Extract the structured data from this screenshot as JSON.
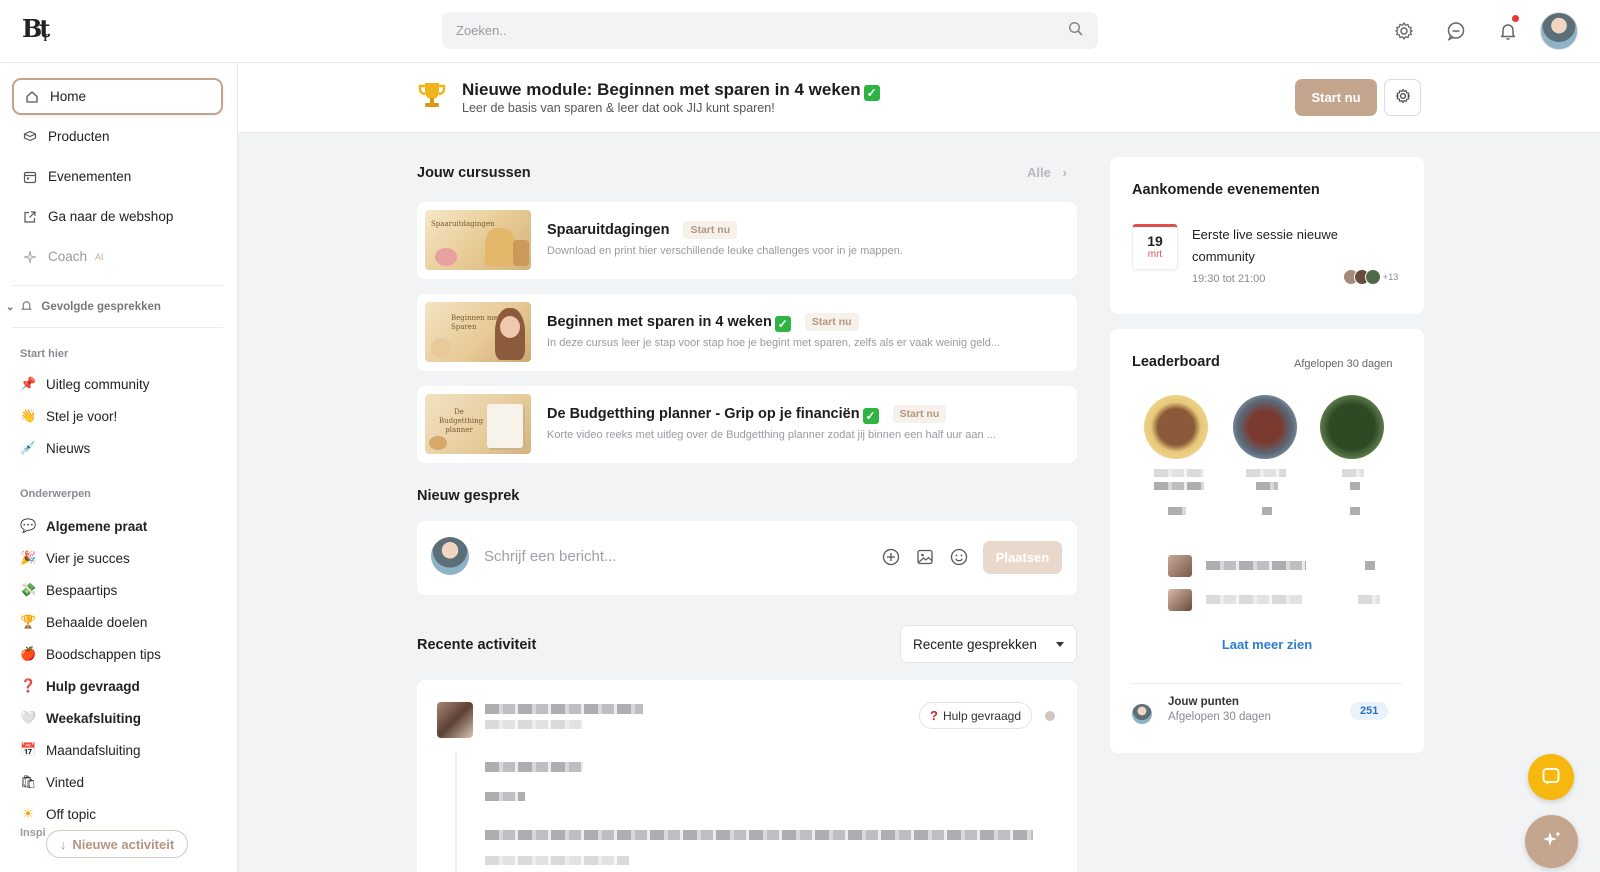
{
  "header": {
    "search_placeholder": "Zoeken..",
    "icons": [
      "settings-gear-icon",
      "chat-bubble-icon",
      "bell-icon"
    ]
  },
  "sidebar": {
    "items": [
      {
        "label": "Home",
        "icon": "home-icon",
        "active": true
      },
      {
        "label": "Producten",
        "icon": "box-icon"
      },
      {
        "label": "Evenementen",
        "icon": "calendar-icon"
      },
      {
        "label": "Ga naar de webshop",
        "icon": "external-link-icon"
      },
      {
        "label": "Coach",
        "icon": "sparkle-icon",
        "tag": "AI"
      }
    ],
    "followed": "Gevolgde gesprekken",
    "section_start": "Start hier",
    "start_channels": [
      {
        "label": "Uitleg community",
        "emoji": "📌"
      },
      {
        "label": "Stel je voor!",
        "emoji": "👋"
      },
      {
        "label": "Nieuws",
        "emoji": "💉"
      }
    ],
    "section_topics": "Onderwerpen",
    "topic_channels": [
      {
        "label": "Algemene praat",
        "emoji": "💬",
        "bold": true
      },
      {
        "label": "Vier je succes",
        "emoji": "🎉"
      },
      {
        "label": "Bespaartips",
        "emoji": "💸"
      },
      {
        "label": "Behaalde doelen",
        "emoji": "🏆"
      },
      {
        "label": "Boodschappen tips",
        "emoji": "🍎"
      },
      {
        "label": "Hulp gevraagd",
        "emoji": "❓",
        "bold": true
      },
      {
        "label": "Weekafsluiting",
        "emoji": "🤍",
        "bold": true
      },
      {
        "label": "Maandafsluiting",
        "emoji": "📅"
      },
      {
        "label": "Vinted",
        "emoji": "🛍"
      },
      {
        "label": "Off topic",
        "emoji": "☀"
      }
    ],
    "section_inspi": "Inspi",
    "new_activity": "Nieuwe activiteit"
  },
  "banner": {
    "title": "Nieuwe module: Beginnen met sparen in 4 weken",
    "subtitle": "Leer de basis van sparen & leer dat ook JIJ kunt sparen!",
    "start_label": "Start nu"
  },
  "courses": {
    "heading": "Jouw cursussen",
    "all_label": "Alle",
    "items": [
      {
        "title": "Spaaruitdagingen",
        "check": false,
        "badge": "Start nu",
        "desc": "Download en print hier verschillende leuke challenges voor in je mappen.",
        "thumb_text": "Spaaruitdagingen"
      },
      {
        "title": "Beginnen met sparen in 4 weken",
        "check": true,
        "badge": "Start nu",
        "desc": "In deze cursus leer je stap voor stap hoe je begint met sparen, zelfs als er vaak weinig geld...",
        "thumb_text": "Beginnen met Sparen"
      },
      {
        "title": "De Budgetthing planner - Grip op je financiën",
        "check": true,
        "badge": "Start nu",
        "desc": "Korte video reeks met uitleg over de Budgetthing planner zodat jij binnen een half uur aan ...",
        "thumb_text": "De Budgetthing planner"
      }
    ]
  },
  "composer": {
    "heading": "Nieuw gesprek",
    "placeholder": "Schrijf een bericht...",
    "post_label": "Plaatsen"
  },
  "activity": {
    "heading": "Recente activiteit",
    "sort_value": "Recente gesprekken",
    "post_tag": "Hulp gevraagd"
  },
  "events": {
    "heading": "Aankomende evenementen",
    "items": [
      {
        "day": "19",
        "month": "mrt",
        "title": "Eerste live sessie nieuwe community",
        "time": "19:30 tot 21:00",
        "more": "+13"
      }
    ]
  },
  "leaderboard": {
    "heading": "Leaderboard",
    "period": "Afgelopen 30 dagen",
    "more_label": "Laat meer zien",
    "points_label": "Jouw punten",
    "points_period": "Afgelopen 30 dagen",
    "points_value": "251"
  }
}
